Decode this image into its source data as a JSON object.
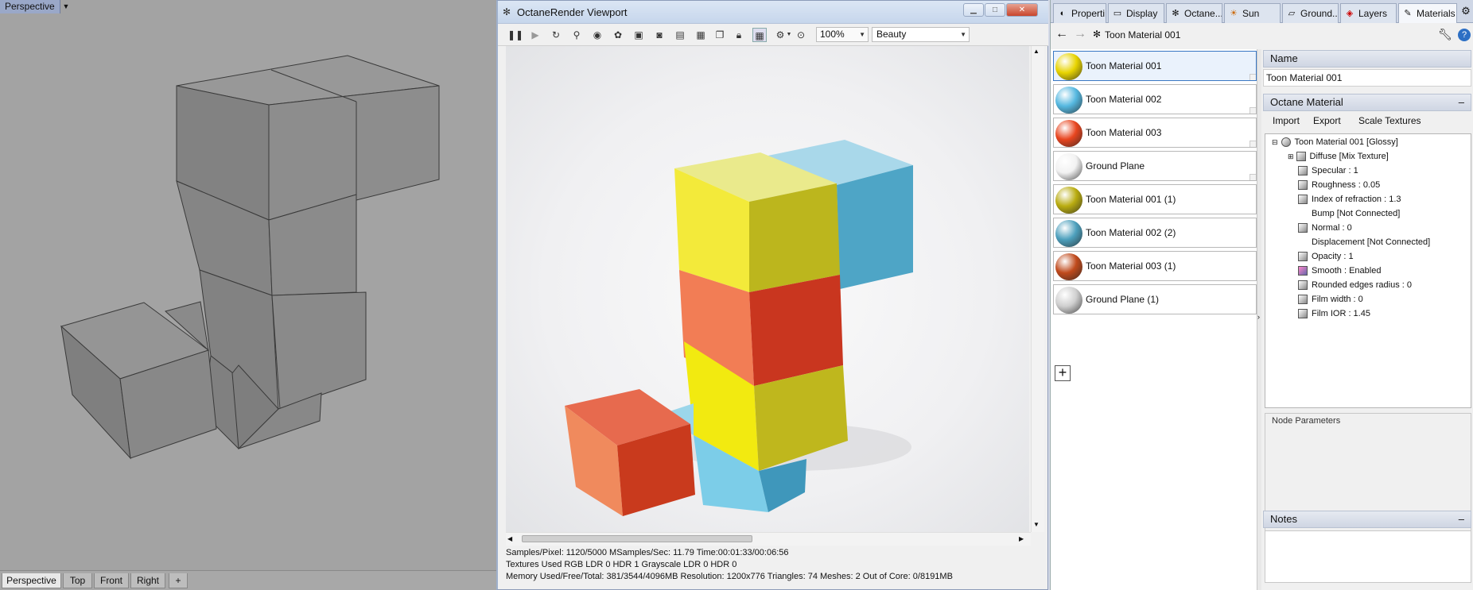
{
  "viewport": {
    "title": "Perspective",
    "tabs": [
      "Perspective",
      "Top",
      "Front",
      "Right"
    ],
    "add_tab": "+"
  },
  "octane": {
    "window_title": "OctaneRender Viewport",
    "zoom": "100%",
    "pass": "Beauty",
    "stats": {
      "line1": "Samples/Pixel: 1120/5000  MSamples/Sec: 11.79  Time:00:01:33/00:06:56",
      "line2": "Textures Used RGB LDR 0  HDR 1  Grayscale LDR 0  HDR 0",
      "line3": "Memory Used/Free/Total: 381/3544/4096MB  Resolution: 1200x776  Triangles: 74  Meshes: 2 Out of Core: 0/8191MB"
    }
  },
  "panel": {
    "tabs": [
      "Properti...",
      "Display",
      "Octane...",
      "Sun",
      "Ground...",
      "Layers",
      "Materials"
    ],
    "breadcrumb": "Toon Material 001",
    "materials": [
      {
        "name": "Toon Material 001",
        "color": "#e8d400"
      },
      {
        "name": "Toon Material 002",
        "color": "#55b8e0"
      },
      {
        "name": "Toon Material 003",
        "color": "#e8451f"
      },
      {
        "name": "Ground Plane",
        "color": "#f2f2f2"
      },
      {
        "name": "Toon Material 001 (1)",
        "color": "#b9ac10"
      },
      {
        "name": "Toon Material 002 (2)",
        "color": "#4da0bd"
      },
      {
        "name": "Toon Material 003 (1)",
        "color": "#c04a1c"
      },
      {
        "name": "Ground Plane (1)",
        "color": "#cfcfcf"
      }
    ],
    "add_material": "+",
    "name_header": "Name",
    "name_value": "Toon Material 001",
    "octane_header": "Octane Material",
    "actions": [
      "Import",
      "Export",
      "Scale Textures"
    ],
    "tree": [
      "Toon Material 001  [Glossy]",
      "Diffuse  [Mix Texture]",
      "Specular : 1",
      "Roughness : 0.05",
      "Index of refraction : 1.3",
      "Bump  [Not Connected]",
      "Normal : 0",
      "Displacement  [Not Connected]",
      "Opacity : 1",
      "Smooth : Enabled",
      "Rounded edges radius : 0",
      "Film width : 0",
      "Film IOR : 1.45"
    ],
    "node_params": "Node Parameters",
    "notes_header": "Notes",
    "collapse": "–"
  }
}
